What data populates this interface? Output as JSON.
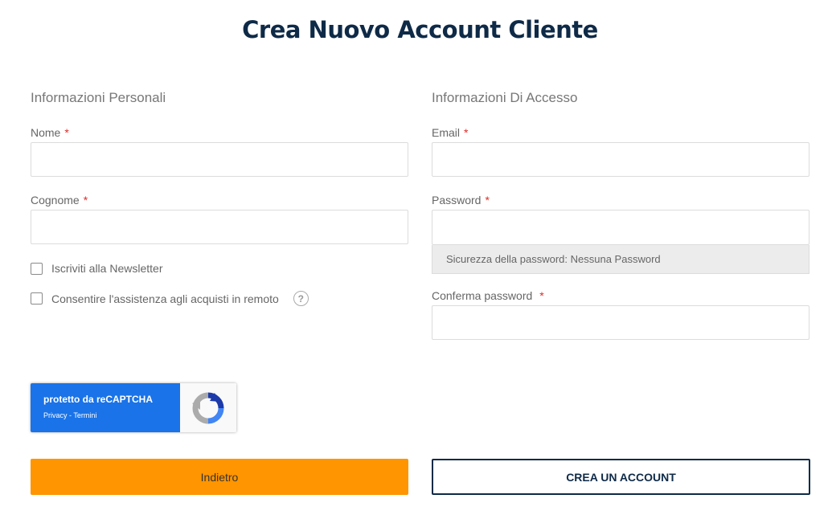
{
  "page": {
    "title": "Crea Nuovo Account Cliente"
  },
  "personal": {
    "section_title": "Informazioni Personali",
    "first_name": {
      "label": "Nome",
      "required": "*",
      "value": "",
      "placeholder": ""
    },
    "last_name": {
      "label": "Cognome",
      "required": "*",
      "value": "",
      "placeholder": ""
    },
    "newsletter": {
      "label": "Iscriviti alla Newsletter",
      "checked": false
    },
    "remote_assist": {
      "label": "Consentire l'assistenza agli acquisti in remoto",
      "checked": false,
      "help_glyph": "?"
    }
  },
  "access": {
    "section_title": "Informazioni Di Accesso",
    "email": {
      "label": "Email",
      "required": "*",
      "value": "",
      "placeholder": ""
    },
    "password": {
      "label": "Password",
      "required": "*",
      "value": "",
      "placeholder": ""
    },
    "password_strength": "Sicurezza della password: Nessuna Password",
    "confirm_password": {
      "label": "Conferma password",
      "required": "*",
      "value": "",
      "placeholder": ""
    }
  },
  "recaptcha": {
    "main_text": "protetto da reCAPTCHA",
    "privacy": "Privacy",
    "separator": " - ",
    "terms": "Termini",
    "logo_icon": "recaptcha-logo-icon"
  },
  "actions": {
    "back_label": "Indietro",
    "create_label": "CREA UN ACCOUNT"
  },
  "colors": {
    "primary": "#0e2a47",
    "accent": "#ff9500",
    "required": "#e02b27",
    "recaptcha_blue": "#1a73e8"
  }
}
